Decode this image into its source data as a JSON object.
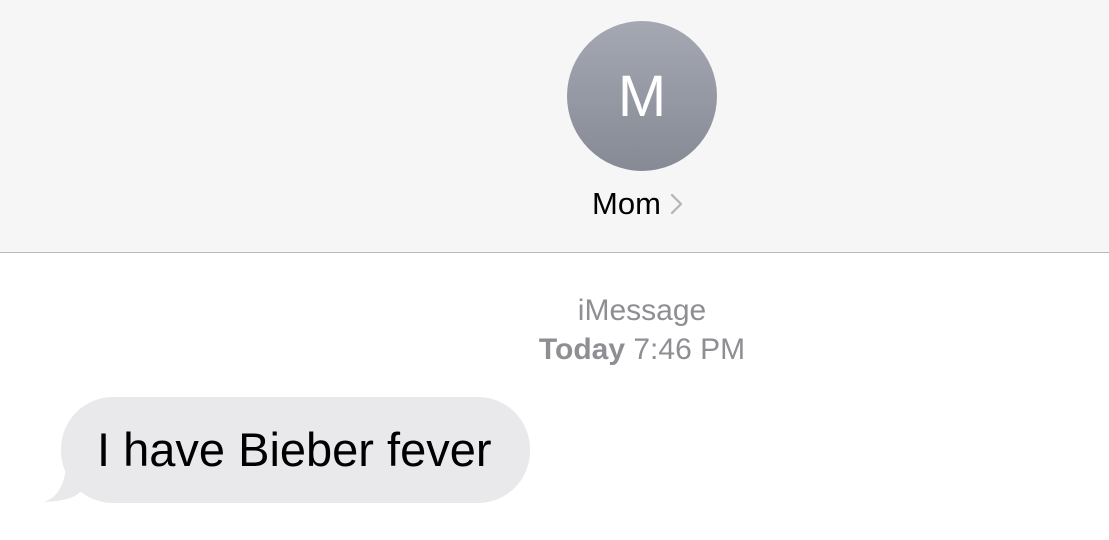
{
  "conversation_header": {
    "avatar_initial": "M",
    "contact_name": "Mom",
    "chevron_icon": "chevron-right-icon"
  },
  "thread": {
    "service": "iMessage",
    "timestamp_day": "Today",
    "timestamp_time": "7:46 PM"
  },
  "messages": [
    {
      "direction": "incoming",
      "text": "I have Bieber fever"
    }
  ],
  "colors": {
    "header_bg": "#f6f6f6",
    "avatar_gradient_top": "#a5a8b2",
    "avatar_gradient_bottom": "#868a94",
    "incoming_bubble": "#e9e9eb",
    "secondary_text": "#8e8e93"
  }
}
